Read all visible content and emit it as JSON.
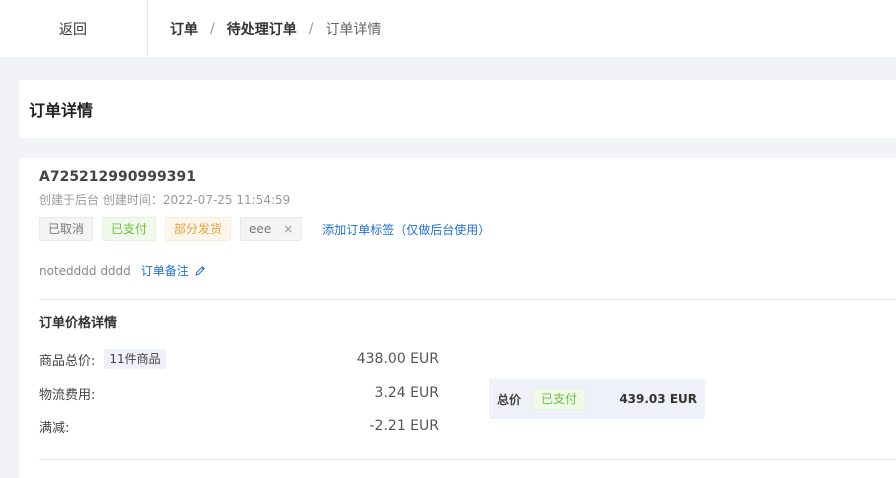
{
  "topbar": {
    "back_label": "返回",
    "breadcrumb": [
      "订单",
      "待处理订单",
      "订单详情"
    ],
    "separator": "/"
  },
  "page_title": "订单详情",
  "order": {
    "number": "A725212990999391",
    "created": "创建于后台 创建时间：2022-07-25 11:54:59",
    "tags": [
      {
        "label": "已取消",
        "style": "grey"
      },
      {
        "label": "已支付",
        "style": "green"
      },
      {
        "label": "部分发货",
        "style": "orange"
      },
      {
        "label": "eee",
        "style": "grey",
        "closable": true
      }
    ],
    "close_glyph": "×",
    "add_tag_label": "添加订单标签（仅做后台使用）",
    "note_text": "notedddd dddd",
    "note_link": "订单备注"
  },
  "price": {
    "section_title": "订单价格详情",
    "rows": [
      {
        "label": "商品总价:",
        "badge": "11件商品",
        "value": "438.00 EUR"
      },
      {
        "label": "物流费用:",
        "value": "3.24 EUR"
      },
      {
        "label": "满减:",
        "value": "-2.21 EUR"
      }
    ],
    "total_label": "总价",
    "total_status": "已支付",
    "total_amount": "439.03 EUR"
  },
  "colors": {
    "link": "#1e6fd9",
    "paid_green": "#67c23a",
    "orange": "#e6a23c"
  }
}
